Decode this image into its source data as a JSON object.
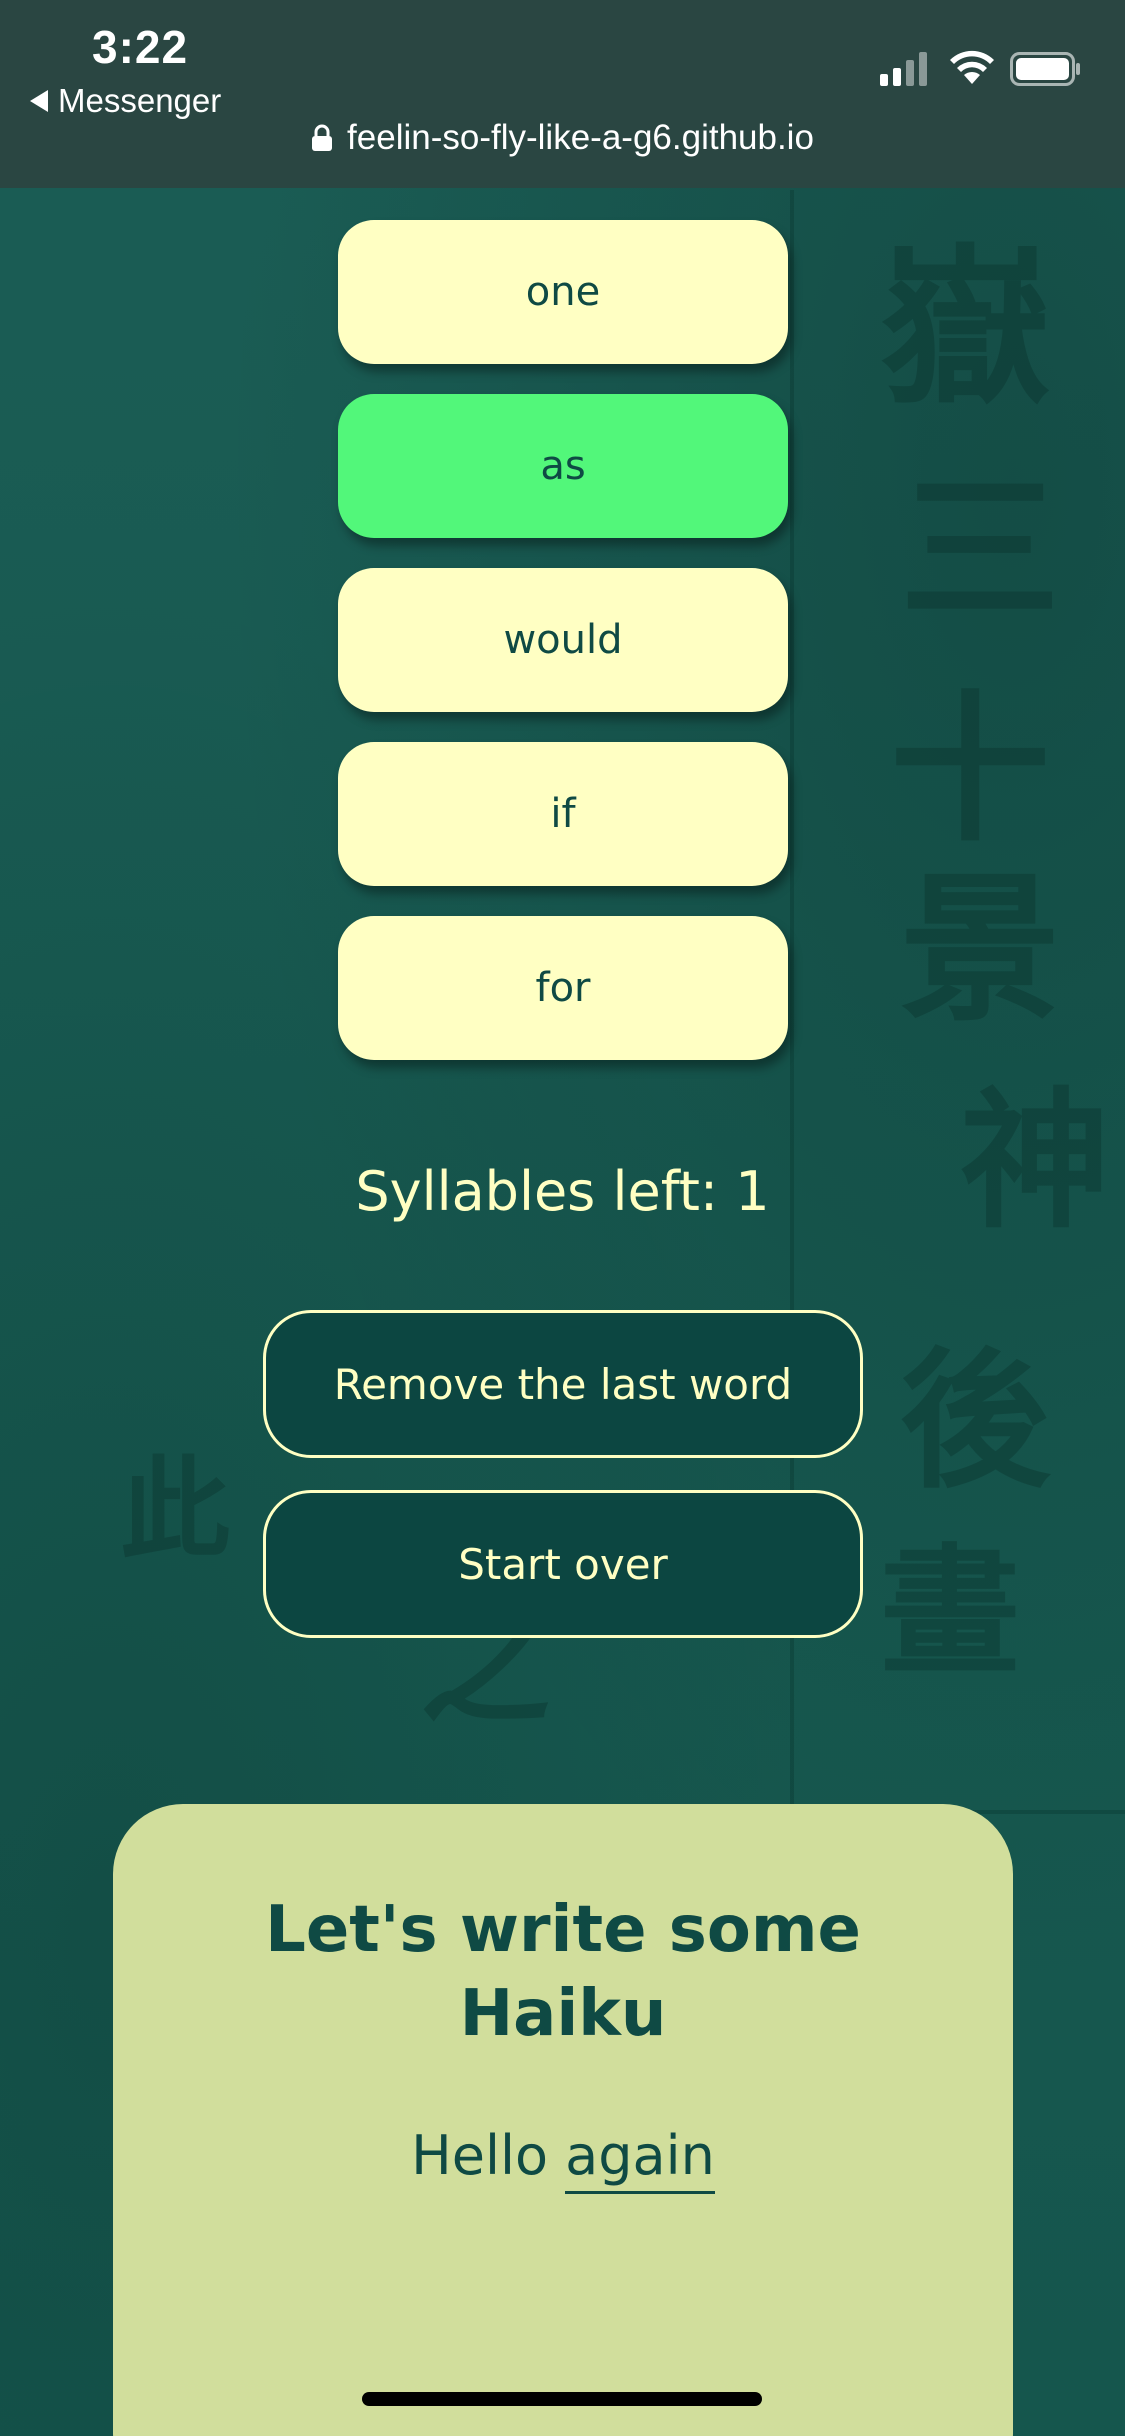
{
  "status_bar": {
    "time": "3:22",
    "back_app": "Messenger",
    "url": "feelin-so-fly-like-a-g6.github.io",
    "icons": [
      "signal-icon",
      "wifi-icon",
      "battery-icon",
      "lock-icon"
    ]
  },
  "word_options": [
    {
      "label": "one",
      "selected": false
    },
    {
      "label": "as",
      "selected": true
    },
    {
      "label": "would",
      "selected": false
    },
    {
      "label": "if",
      "selected": false
    },
    {
      "label": "for",
      "selected": false
    }
  ],
  "syllables_left": "Syllables left: 1",
  "actions": {
    "remove_last": "Remove the last word",
    "start_over": "Start over"
  },
  "card": {
    "title_line1": "Let's write some",
    "title_line2": "Haiku",
    "haiku_word1": "Hello",
    "haiku_word2": "again"
  },
  "colors": {
    "background": "#17584f",
    "button": "#ffffc3",
    "selected": "#52f77a",
    "card": "#d1de9c",
    "text_dark": "#0f4a44"
  }
}
